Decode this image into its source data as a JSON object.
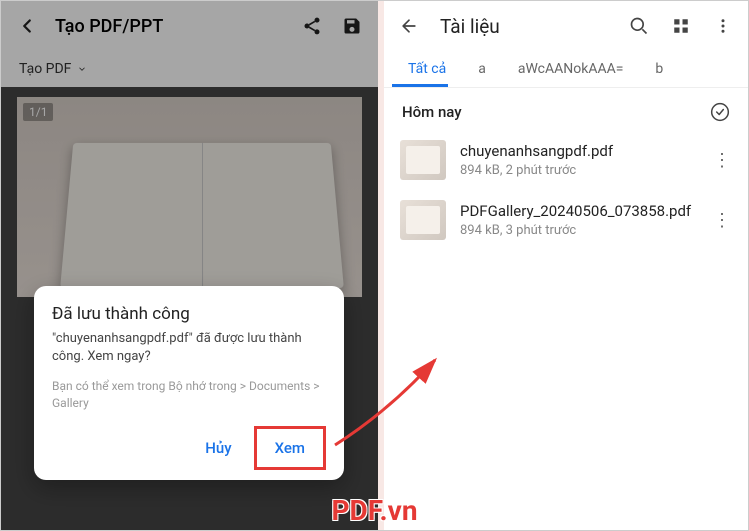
{
  "left": {
    "header_title": "Tạo PDF/PPT",
    "subbar_label": "Tạo PDF",
    "page_counter": "1/1"
  },
  "dialog": {
    "title": "Đã lưu thành công",
    "message": "\"chuyenanhsangpdf.pdf\" đã được lưu thành công. Xem ngay?",
    "hint": "Bạn có thể xem trong Bộ nhớ trong > Documents > Gallery",
    "cancel": "Hủy",
    "view": "Xem"
  },
  "right": {
    "header_title": "Tài liệu",
    "tabs": [
      "Tất cả",
      "a",
      "aWcAANokAAA=",
      "b"
    ],
    "section_title": "Hôm nay",
    "files": [
      {
        "name": "chuyenanhsangpdf.pdf",
        "meta": "894 kB, 2 phút trước"
      },
      {
        "name": "PDFGallery_20240506_073858.pdf",
        "meta": "894 kB, 3 phút trước"
      }
    ]
  },
  "watermark": "PDF.vn"
}
